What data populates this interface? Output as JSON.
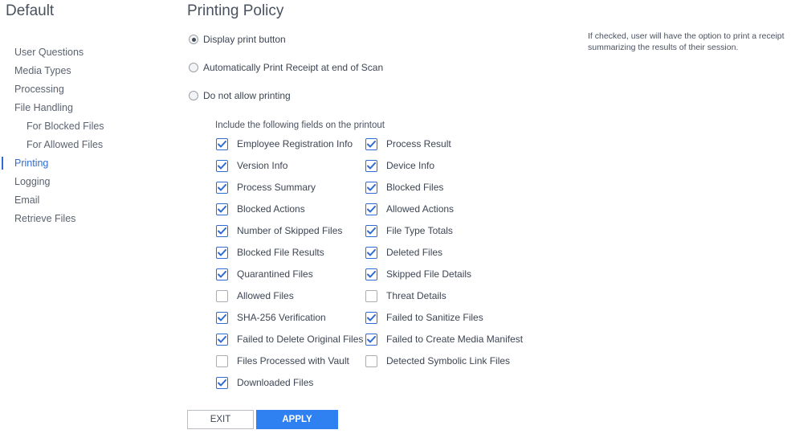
{
  "app": {
    "title": "Default"
  },
  "sidebar": {
    "items": [
      {
        "label": "User Questions",
        "sub": false,
        "active": false,
        "name": "sidebar-item-user-questions"
      },
      {
        "label": "Media Types",
        "sub": false,
        "active": false,
        "name": "sidebar-item-media-types"
      },
      {
        "label": "Processing",
        "sub": false,
        "active": false,
        "name": "sidebar-item-processing"
      },
      {
        "label": "File Handling",
        "sub": false,
        "active": false,
        "name": "sidebar-item-file-handling"
      },
      {
        "label": "For Blocked Files",
        "sub": true,
        "active": false,
        "name": "sidebar-item-for-blocked-files"
      },
      {
        "label": "For Allowed Files",
        "sub": true,
        "active": false,
        "name": "sidebar-item-for-allowed-files"
      },
      {
        "label": "Printing",
        "sub": false,
        "active": true,
        "name": "sidebar-item-printing"
      },
      {
        "label": "Logging",
        "sub": false,
        "active": false,
        "name": "sidebar-item-logging"
      },
      {
        "label": "Email",
        "sub": false,
        "active": false,
        "name": "sidebar-item-email"
      },
      {
        "label": "Retrieve Files",
        "sub": false,
        "active": false,
        "name": "sidebar-item-retrieve-files"
      }
    ]
  },
  "main": {
    "title": "Printing Policy",
    "radios": [
      {
        "label": "Display print button",
        "checked": true
      },
      {
        "label": "Automatically Print Receipt at end of Scan",
        "checked": false
      },
      {
        "label": "Do not allow printing",
        "checked": false
      }
    ],
    "help_text": "If checked, user will have the option to print a receipt summarizing the results of their session.",
    "fields_label": "Include the following fields on the printout",
    "fields_left": [
      {
        "label": "Employee Registration Info",
        "checked": true
      },
      {
        "label": "Version Info",
        "checked": true
      },
      {
        "label": "Process Summary",
        "checked": true
      },
      {
        "label": "Blocked Actions",
        "checked": true
      },
      {
        "label": "Number of Skipped Files",
        "checked": true
      },
      {
        "label": "Blocked File Results",
        "checked": true
      },
      {
        "label": "Quarantined Files",
        "checked": true
      },
      {
        "label": "Allowed Files",
        "checked": false
      },
      {
        "label": "SHA-256 Verification",
        "checked": true
      },
      {
        "label": "Failed to Delete Original Files",
        "checked": true
      },
      {
        "label": "Files Processed with Vault",
        "checked": false
      },
      {
        "label": "Downloaded Files",
        "checked": true
      }
    ],
    "fields_right": [
      {
        "label": "Process Result",
        "checked": true
      },
      {
        "label": "Device Info",
        "checked": true
      },
      {
        "label": "Blocked Files",
        "checked": true
      },
      {
        "label": "Allowed Actions",
        "checked": true
      },
      {
        "label": "File Type Totals",
        "checked": true
      },
      {
        "label": "Deleted Files",
        "checked": true
      },
      {
        "label": "Skipped File Details",
        "checked": true
      },
      {
        "label": "Threat Details",
        "checked": false
      },
      {
        "label": "Failed to Sanitize Files",
        "checked": true
      },
      {
        "label": "Failed to Create Media Manifest",
        "checked": true
      },
      {
        "label": "Detected Symbolic Link Files",
        "checked": false
      }
    ],
    "buttons": {
      "exit": "EXIT",
      "apply": "APPLY"
    }
  },
  "colors": {
    "accent": "#2f6bd0",
    "apply_button": "#2f80f0"
  }
}
